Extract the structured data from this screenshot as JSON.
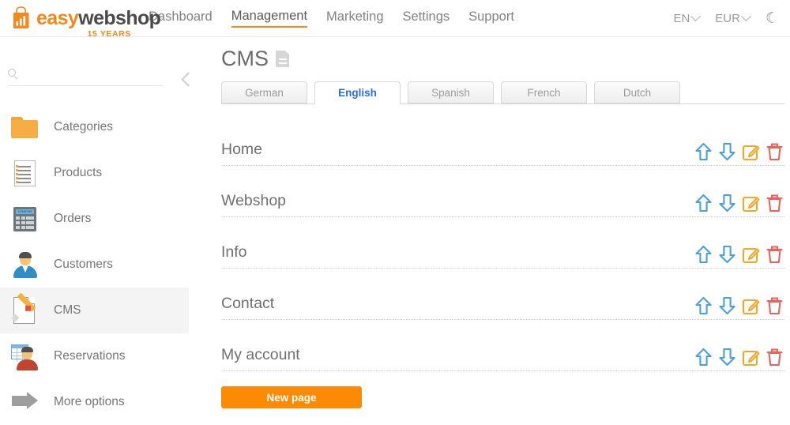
{
  "header": {
    "logo": {
      "part1": "easy",
      "part2": "webshop",
      "tagline": "15 YEARS",
      "icon": "shopping-bag-chart-icon"
    },
    "nav": [
      {
        "label": "Dashboard",
        "active": false
      },
      {
        "label": "Management",
        "active": true
      },
      {
        "label": "Marketing",
        "active": false
      },
      {
        "label": "Settings",
        "active": false
      },
      {
        "label": "Support",
        "active": false
      }
    ],
    "language": "EN",
    "currency": "EUR",
    "theme_toggle_icon": "moon-icon",
    "theme_toggle_glyph": "☾"
  },
  "sidebar": {
    "search": {
      "value": "",
      "placeholder": ""
    },
    "collapse_icon": "chevron-left-icon",
    "items": [
      {
        "label": "Categories",
        "icon": "folder-icon",
        "active": false
      },
      {
        "label": "Products",
        "icon": "document-list-icon",
        "active": false
      },
      {
        "label": "Orders",
        "icon": "calculator-icon",
        "active": false
      },
      {
        "label": "Customers",
        "icon": "person-icon",
        "active": false
      },
      {
        "label": "CMS",
        "icon": "page-pencil-icon",
        "active": true
      },
      {
        "label": "Reservations",
        "icon": "table-person-icon",
        "active": false
      },
      {
        "label": "More options",
        "icon": "arrow-right-icon",
        "active": false
      }
    ],
    "calculator_screen_text": "12345789"
  },
  "main": {
    "title": "CMS",
    "title_icon": "document-icon",
    "tabs": [
      {
        "label": "German",
        "active": false
      },
      {
        "label": "English",
        "active": true
      },
      {
        "label": "Spanish",
        "active": false
      },
      {
        "label": "French",
        "active": false
      },
      {
        "label": "Dutch",
        "active": false
      }
    ],
    "pages": [
      {
        "name": "Home"
      },
      {
        "name": "Webshop"
      },
      {
        "name": "Info"
      },
      {
        "name": "Contact"
      },
      {
        "name": "My account"
      }
    ],
    "row_actions": [
      {
        "name": "move-up-icon",
        "title": "Move up"
      },
      {
        "name": "move-down-icon",
        "title": "Move down"
      },
      {
        "name": "edit-icon",
        "title": "Edit"
      },
      {
        "name": "delete-icon",
        "title": "Delete"
      }
    ],
    "new_page_button": "New page"
  },
  "colors": {
    "brand_orange": "#f9861a",
    "button_orange": "#fc8a04",
    "active_tab_blue": "#2b6fd8",
    "arrow_blue": "#4a9fdc",
    "edit_orange": "#f5a623",
    "delete_red": "#e8635c",
    "text_gray": "#6f6f6f"
  }
}
